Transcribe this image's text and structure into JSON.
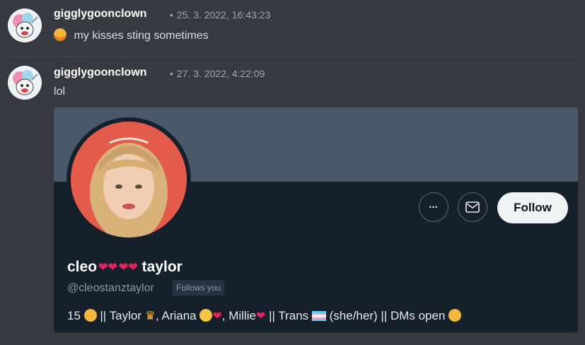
{
  "messages": [
    {
      "username": "gigglygoonclown",
      "timestamp": "25. 3. 2022, 16:43:23",
      "text": "my kisses sting sometimes"
    },
    {
      "username": "gigglygoonclown",
      "timestamp": "27. 3. 2022, 4:22:09",
      "text": "lol"
    }
  ],
  "separator": "•",
  "embed": {
    "display_name_part1": "cleo",
    "display_name_part2": "taylor",
    "handle": "@cleostanztaylor",
    "follows_you": "Follows you",
    "follow_label": "Follow",
    "bio": {
      "p1": "15",
      "p2": "|| Taylor",
      "p3": ", Ariana",
      "p4": ", Millie",
      "p5": "|| Trans",
      "p6": "(she/her) || DMs open"
    },
    "more_glyph": "•••"
  },
  "colors": {
    "background": "#36393f",
    "embed_bg": "#15202b",
    "banner": "#4a5969",
    "heart": "#e0245e"
  }
}
